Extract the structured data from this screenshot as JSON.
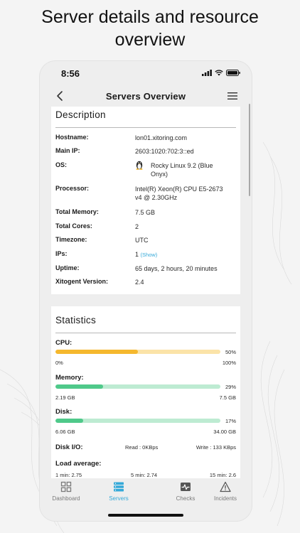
{
  "headline": {
    "line1": "Server details and resource",
    "line2": "overview"
  },
  "status_bar": {
    "time": "8:56"
  },
  "nav": {
    "title": "Servers Overview",
    "back_icon": "chevron-left-icon",
    "menu_icon": "hamburger-menu-icon"
  },
  "description": {
    "title": "Description",
    "rows": {
      "hostname": {
        "label": "Hostname:",
        "value": "lon01.xitoring.com"
      },
      "main_ip": {
        "label": "Main IP:",
        "value": "2603:1020:702:3::ed"
      },
      "os": {
        "label": "OS:",
        "line1": "Rocky Linux 9.2 (Blue",
        "line2": "Onyx)",
        "icon": "linux-penguin-icon"
      },
      "processor": {
        "label": "Processor:",
        "line1": "Intel(R) Xeon(R) CPU E5-2673",
        "line2": "v4 @ 2.30GHz"
      },
      "total_memory": {
        "label": "Total Memory:",
        "value": "7.5 GB"
      },
      "total_cores": {
        "label": "Total Cores:",
        "value": "2"
      },
      "timezone": {
        "label": "Timezone:",
        "value": "UTC"
      },
      "ips": {
        "label": "IPs:",
        "value": "1",
        "link": "(Show)"
      },
      "uptime": {
        "label": "Uptime:",
        "value": "65 days, 2 hours, 20 minutes"
      },
      "xitogent_version": {
        "label": "Xitogent Version:",
        "value": "2.4"
      }
    }
  },
  "statistics": {
    "title": "Statistics",
    "cpu": {
      "label": "CPU:",
      "percent": 50,
      "percent_text": "50%",
      "min": "0%",
      "max": "100%",
      "fill": "#f5b82e",
      "track": "#fbe3a8"
    },
    "memory": {
      "label": "Memory:",
      "percent": 29,
      "percent_text": "29%",
      "min": "2.19 GB",
      "max": "7.5 GB",
      "fill": "#4fc98a",
      "track": "#bdebd2"
    },
    "disk": {
      "label": "Disk:",
      "percent": 17,
      "percent_text": "17%",
      "min": "6.06 GB",
      "max": "34.00 GB",
      "fill": "#4fc98a",
      "track": "#bdebd2"
    },
    "disk_io": {
      "label": "Disk I/O:",
      "read": "Read : 0KBps",
      "write": "Write : 133 KBps"
    },
    "load": {
      "label": "Load average:",
      "min1": "1 min: 2.75",
      "min5": "5 min: 2.74",
      "min15": "15 min: 2.6"
    }
  },
  "tabs": [
    {
      "label": "Dashboard",
      "icon": "dashboard-grid-icon",
      "active": false
    },
    {
      "label": "Servers",
      "icon": "servers-stack-icon",
      "active": true
    },
    {
      "label": "Checks",
      "icon": "pulse-check-icon",
      "active": false
    },
    {
      "label": "Incidents",
      "icon": "warning-triangle-icon",
      "active": false
    }
  ],
  "colors": {
    "accent": "#35a9d8"
  }
}
